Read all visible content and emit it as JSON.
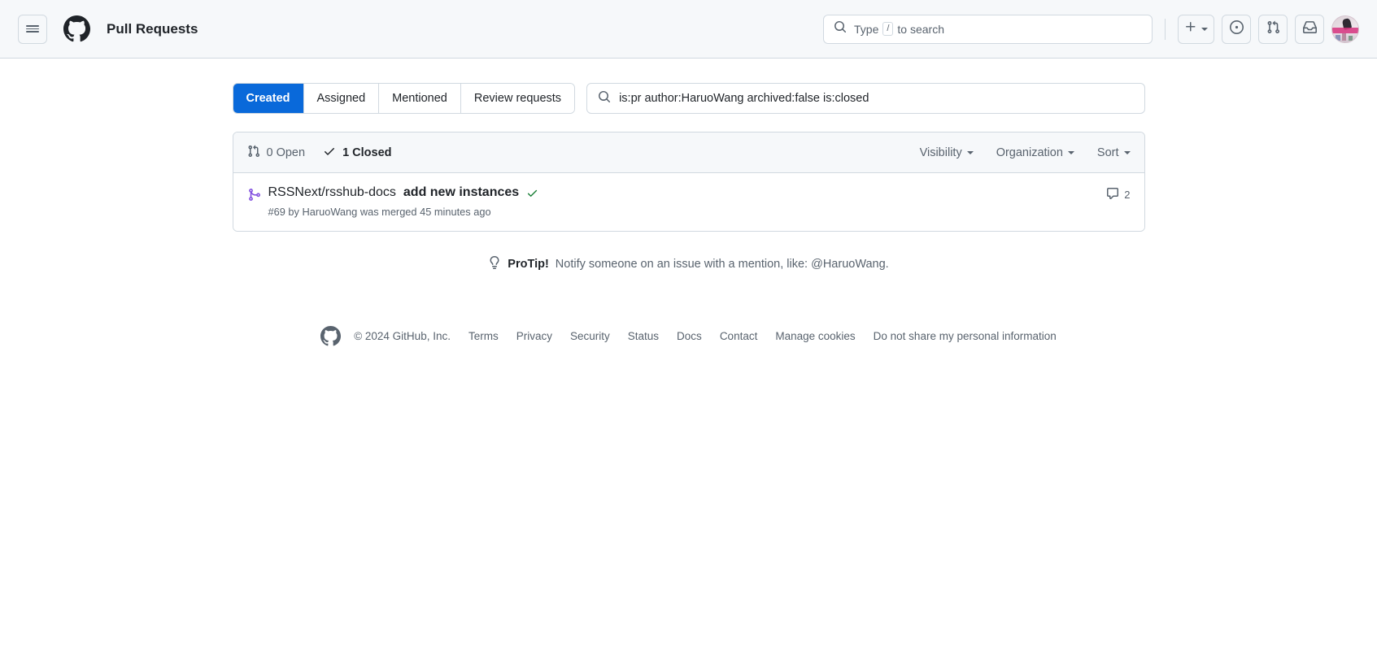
{
  "header": {
    "menu_icon": "hamburger-icon",
    "logo_icon": "github-logo-icon",
    "title": "Pull Requests",
    "search": {
      "icon": "search-icon",
      "prefix": "Type",
      "key": "/",
      "suffix": "to search"
    },
    "create_button": {
      "icon": "plus-icon",
      "caret": "chevron-down-icon"
    },
    "issues_button": {
      "icon": "issue-opened-icon"
    },
    "pulls_button": {
      "icon": "pull-request-icon"
    },
    "inbox_button": {
      "icon": "inbox-icon"
    },
    "avatar": {
      "icon": "avatar",
      "alt": "HaruoWang"
    }
  },
  "tabs": [
    {
      "label": "Created",
      "active": true
    },
    {
      "label": "Assigned",
      "active": false
    },
    {
      "label": "Mentioned",
      "active": false
    },
    {
      "label": "Review requests",
      "active": false
    }
  ],
  "query": {
    "icon": "search-icon",
    "value": "is:pr author:HaruoWang archived:false is:closed",
    "placeholder": "Search all issues"
  },
  "list_header": {
    "open": {
      "icon": "pull-request-icon",
      "label": "0 Open"
    },
    "closed": {
      "icon": "check-icon",
      "label": "1 Closed"
    },
    "filters": [
      {
        "label": "Visibility",
        "caret": "chevron-down-icon"
      },
      {
        "label": "Organization",
        "caret": "chevron-down-icon"
      },
      {
        "label": "Sort",
        "caret": "chevron-down-icon"
      }
    ]
  },
  "pull_requests": [
    {
      "state_icon": "git-merge-icon",
      "state_color": "#8250df",
      "repo": "RSSNext/rsshub-docs",
      "title": "add new instances",
      "check_icon": "check-success-icon",
      "check_color": "#1a7f37",
      "meta": "#69 by HaruoWang was merged 45 minutes ago",
      "comments": {
        "icon": "comment-icon",
        "count": "2"
      }
    }
  ],
  "protip": {
    "icon": "lightbulb-icon",
    "label": "ProTip!",
    "text": "Notify someone on an issue with a mention, like: @HaruoWang."
  },
  "footer": {
    "logo_icon": "github-mark-icon",
    "copyright": "© 2024 GitHub, Inc.",
    "links": [
      "Terms",
      "Privacy",
      "Security",
      "Status",
      "Docs",
      "Contact",
      "Manage cookies",
      "Do not share my personal information"
    ]
  },
  "colors": {
    "accent": "#0969da",
    "merged": "#8250df",
    "success": "#1a7f37",
    "muted": "#59636e",
    "border": "#d1d9e0",
    "surface": "#f6f8fa"
  }
}
